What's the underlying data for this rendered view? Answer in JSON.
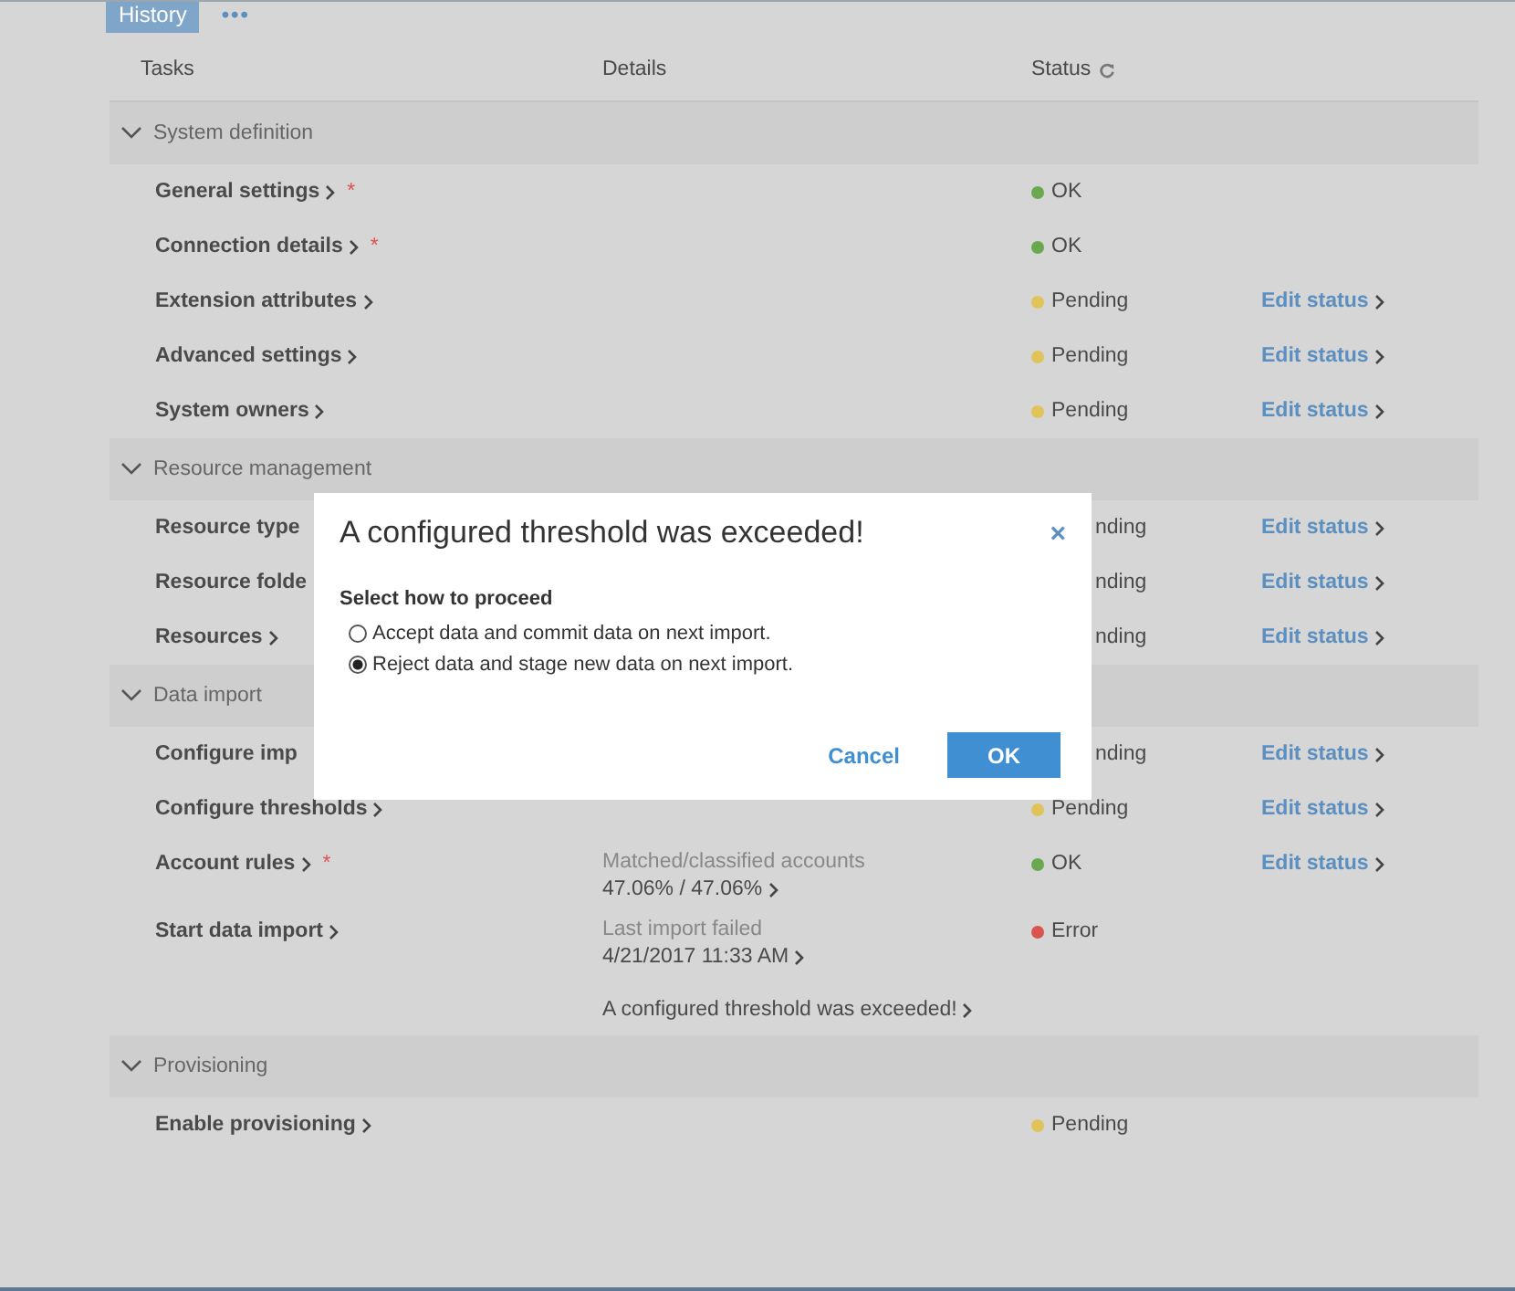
{
  "tabs": [
    {
      "label": "History",
      "selected": true
    }
  ],
  "more_label": "•••",
  "columns": [
    "Tasks",
    "Details",
    "Status"
  ],
  "sections": [
    {
      "title": "System definition",
      "expanded": true,
      "rows": [
        {
          "task": "General settings",
          "chevron": true,
          "mark": "*",
          "status": {
            "label": "OK",
            "color": "#6aa84f"
          }
        },
        {
          "task": "Connection details",
          "chevron": true,
          "mark": "*",
          "status": {
            "label": "OK",
            "color": "#6aa84f"
          }
        },
        {
          "task": "Extension attributes",
          "chevron": true,
          "status": {
            "label": "Pending",
            "color": "#e0c35a"
          },
          "action": "Edit status"
        },
        {
          "task": "Advanced settings",
          "chevron": true,
          "status": {
            "label": "Pending",
            "color": "#e0c35a"
          },
          "action": "Edit status"
        },
        {
          "task": "System owners",
          "chevron": true,
          "status": {
            "label": "Pending",
            "color": "#e0c35a"
          },
          "action": "Edit status"
        }
      ]
    },
    {
      "title": "Resource management",
      "expanded": true,
      "rows": [
        {
          "task": "Resource type",
          "chevron": false,
          "status": {
            "label": "nding"
          },
          "action": "Edit status"
        },
        {
          "task": "Resource folde",
          "chevron": false,
          "status": {
            "label": "nding"
          },
          "action": "Edit status"
        },
        {
          "task": "Resources",
          "chevron": true,
          "status": {
            "label": "nding"
          },
          "action": "Edit status"
        }
      ]
    },
    {
      "title": "Data import",
      "expanded": true,
      "rows": [
        {
          "task": "Configure imp",
          "chevron": false,
          "status": {
            "label": "nding"
          },
          "action": "Edit status"
        },
        {
          "task": "Configure thresholds",
          "chevron": true,
          "status": {
            "label": "Pending",
            "color": "#e0c35a"
          },
          "action": "Edit status"
        },
        {
          "task": "Account rules",
          "chevron": true,
          "mark": "*",
          "details": [
            {
              "kind": "caption",
              "text": "Matched/classified accounts"
            },
            {
              "kind": "link",
              "text": "47.06% / 47.06%"
            }
          ],
          "status": {
            "label": "OK",
            "color": "#6aa84f"
          },
          "action": "Edit status"
        },
        {
          "task": "Start data import",
          "chevron": true,
          "details": [
            {
              "kind": "caption",
              "text": "Last import failed"
            },
            {
              "kind": "link",
              "text": "4/21/2017 11:33 AM"
            },
            {
              "kind": "note",
              "text": "A configured threshold was exceeded!"
            }
          ],
          "status": {
            "label": "Error",
            "color": "#d9534f"
          }
        }
      ]
    },
    {
      "title": "Provisioning",
      "expanded": true,
      "rows": [
        {
          "task": "Enable provisioning",
          "chevron": true,
          "status": {
            "label": "Pending",
            "color": "#e0c35a"
          }
        }
      ]
    }
  ],
  "dialog": {
    "title": "A configured threshold was exceeded!",
    "close": "×",
    "prompt": "Select how to proceed",
    "options": [
      {
        "label": "Accept data and commit data on next import.",
        "selected": false
      },
      {
        "label": "Reject data and stage new data on next import.",
        "selected": true
      }
    ],
    "cancel": "Cancel",
    "ok": "OK"
  }
}
